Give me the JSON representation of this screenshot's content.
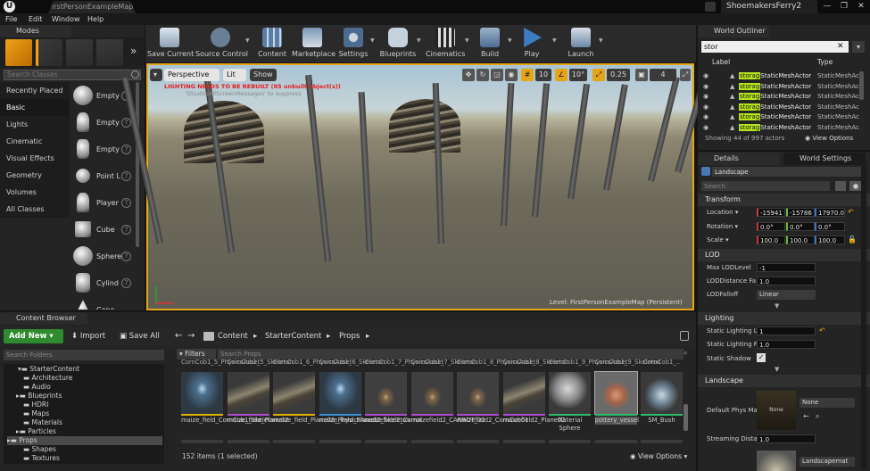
{
  "window": {
    "tab_title": "FirstPersonExampleMap*",
    "project": "ShoemakersFerry2",
    "minimize": "—",
    "maximize": "❐",
    "close": "✕"
  },
  "menu": [
    "File",
    "Edit",
    "Window",
    "Help"
  ],
  "modes": {
    "title": "Modes",
    "search_placeholder": "Search Classes",
    "categories": [
      "Recently Placed",
      "Basic",
      "Lights",
      "Cinematic",
      "Visual Effects",
      "Geometry",
      "Volumes",
      "All Classes"
    ],
    "selected_category": "Basic",
    "items": [
      "Empty",
      "Empty",
      "Empty",
      "Point L",
      "Player",
      "Cube",
      "Sphere",
      "Cylind",
      "Cone"
    ]
  },
  "toolbar": {
    "buttons": [
      "Save Current",
      "Source Control",
      "Content",
      "Marketplace",
      "Settings",
      "Blueprints",
      "Cinematics",
      "Build",
      "Play",
      "Launch"
    ]
  },
  "viewport": {
    "perspective": "Perspective",
    "lit": "Lit",
    "show": "Show",
    "warning": "LIGHTING NEEDS TO BE REBUILT (85 unbuilt object(s))",
    "warning_hint": "'DisableAllScreenMessages' to suppress",
    "snap_grid": "10",
    "snap_rot": "10°",
    "snap_scale": "0.25",
    "cam_speed": "4",
    "level": "Level:  FirstPersonExampleMap (Persistent)"
  },
  "outliner": {
    "title": "World Outliner",
    "search": "stor",
    "col_label": "Label",
    "col_type": "Type",
    "rows": [
      {
        "hl": "storag",
        "name": "StaticMeshActor",
        "type": "StaticMeshAc"
      },
      {
        "hl": "storag",
        "name": "StaticMeshActor",
        "type": "StaticMeshAc"
      },
      {
        "hl": "storag",
        "name": "StaticMeshActor",
        "type": "StaticMeshAc"
      },
      {
        "hl": "storag",
        "name": "StaticMeshActor",
        "type": "StaticMeshAc"
      },
      {
        "hl": "storag",
        "name": "StaticMeshActor",
        "type": "StaticMeshAc"
      },
      {
        "hl": "storag",
        "name": "StaticMeshActor",
        "type": "StaticMeshAc"
      }
    ],
    "status": "Showing 44 of 997 actors",
    "view_options": "View Options"
  },
  "details": {
    "tab": "Details",
    "tab2": "World Settings",
    "object": "Landscape",
    "search_placeholder": "Search",
    "transform": "Transform",
    "location": "Location",
    "rotation": "Rotation",
    "scale": "Scale",
    "loc": [
      "-15941",
      "-15786",
      "17970.0"
    ],
    "rot": [
      "0.0°",
      "0.0°",
      "0.0°"
    ],
    "scl": [
      "100.0",
      "100.0",
      "100.0"
    ],
    "lod": "LOD",
    "max_lod": "Max LODLevel",
    "max_lod_v": "-1",
    "lod_dist": "LODDistance Fa",
    "lod_dist_v": "1.0",
    "lod_falloff": "LODFalloff",
    "lod_falloff_v": "Linear",
    "lighting": "Lighting",
    "static_light1": "Static Lighting L",
    "static_light1_v": "1",
    "static_light2": "Static Lighting F",
    "static_light2_v": "1.0",
    "static_shadow": "Static Shadow",
    "landscape": "Landscape",
    "phys_mat": "Default Phys Ma",
    "phys_none": "None",
    "phys_thumb": "None",
    "stream_dist": "Streaming Dista",
    "stream_dist_v": "1.0",
    "landscape_mat": "Landscapemat"
  },
  "content_browser": {
    "title": "Content Browser",
    "add_new": "Add New",
    "import": "Import",
    "save_all": "Save All",
    "path": [
      "Content",
      "StarterContent",
      "Props"
    ],
    "search_folders": "Search Folders",
    "search_props": "Search Props",
    "filters": "Filters",
    "tree": [
      "StarterContent",
      "Architecture",
      "Audio",
      "Blueprints",
      "HDRI",
      "Maps",
      "Materials",
      "Particles",
      "Props",
      "Shapes",
      "Textures"
    ],
    "status": "152 items (1 selected)",
    "view_options": "View Options",
    "assets": [
      {
        "top": "CornCob1_5_PhysicsAsset",
        "name": "maize_field_CornCob1_Skeleton",
        "bar": "#e0b000"
      },
      {
        "top": "CornCob1_5_Skeleton",
        "name": "maize_field_Plane02",
        "bar": "#b04ad0"
      },
      {
        "top": "CornCob1_6_PhysicsAsset",
        "name": "maize_field_Plane02_PhysicsAsset",
        "bar": "#e0b000"
      },
      {
        "top": "CornCob1_6_Skeleton",
        "name": "maize_field_Plane02_Skeleton",
        "bar": "#3a8fd8"
      },
      {
        "top": "CornCob1_7_PhysicsAsset",
        "name": "maizefield2_Carrot",
        "bar": "#b04ad0"
      },
      {
        "top": "CornCob1_7_Skeleton",
        "name": "maizefield2_CARROT_02",
        "bar": "#b04ad0"
      },
      {
        "top": "CornCob1_8_PhysicsAsset",
        "name": "maizefield2_CornCob01",
        "bar": "#b04ad0"
      },
      {
        "top": "CornCob1_8_Skeleton",
        "name": "maizefield2_Plane02",
        "bar": "#b04ad0"
      },
      {
        "top": "CornCob1_9_PhysicsAsset",
        "name": "Material Sphere",
        "bar": "#2dbb6a"
      },
      {
        "top": "CornCob1_9_Skeleton",
        "name": "pottery_vessel",
        "bar": "#2dbb6a"
      },
      {
        "top": "CornCob1_..",
        "name": "SM_Bush",
        "bar": "#2dbb6a"
      }
    ]
  }
}
